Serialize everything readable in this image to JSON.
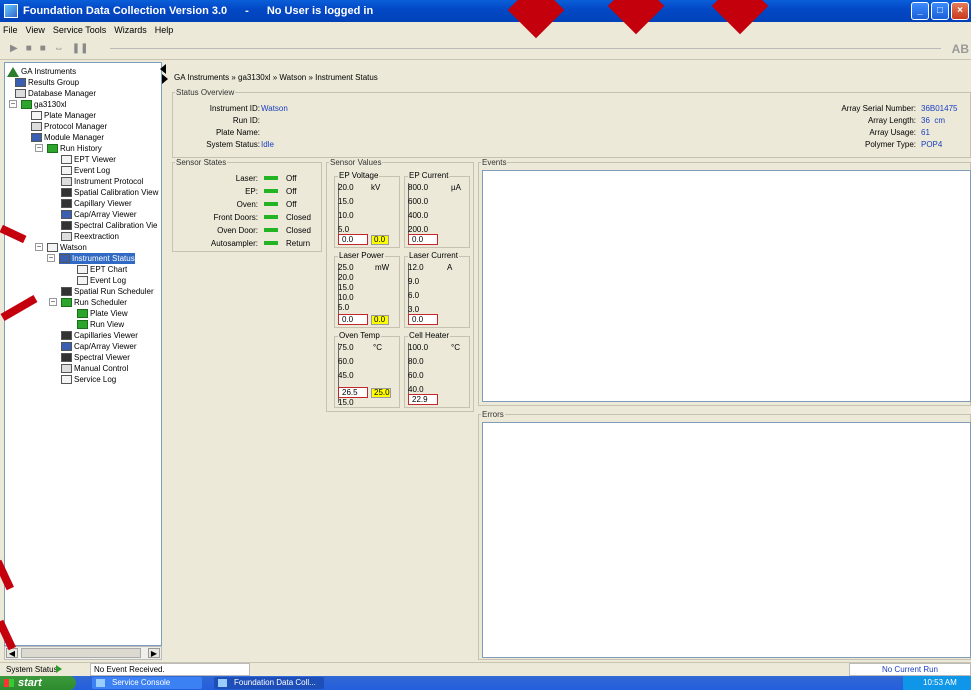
{
  "window": {
    "title": "Foundation Data Collection Version 3.0",
    "separator": "-",
    "user_status": "No User is logged in",
    "brand": "AB"
  },
  "menu": [
    "File",
    "View",
    "Service Tools",
    "Wizards",
    "Help"
  ],
  "tree": {
    "items": [
      {
        "label": "GA Instruments",
        "icon": "triangle-icon"
      },
      {
        "label": "Results Group",
        "icon": "folder-icon"
      },
      {
        "label": "Database Manager",
        "icon": "database-icon"
      },
      {
        "label": "ga3130xl",
        "icon": "instrument-icon"
      },
      {
        "label": "Plate Manager",
        "icon": "plate-icon"
      },
      {
        "label": "Protocol Manager",
        "icon": "protocol-icon"
      },
      {
        "label": "Module Manager",
        "icon": "module-icon"
      },
      {
        "label": "Run History",
        "icon": "history-icon"
      },
      {
        "label": "EPT Viewer",
        "icon": "chart-icon"
      },
      {
        "label": "Event Log",
        "icon": "log-icon"
      },
      {
        "label": "Instrument Protocol",
        "icon": "protocol-icon"
      },
      {
        "label": "Spatial Calibration View",
        "icon": "spatial-icon"
      },
      {
        "label": "Capillary Viewer",
        "icon": "capillary-icon"
      },
      {
        "label": "Cap/Array Viewer",
        "icon": "array-icon"
      },
      {
        "label": "Spectral Calibration Vie",
        "icon": "spectral-icon"
      },
      {
        "label": "Reextraction",
        "icon": "reextraction-icon"
      },
      {
        "label": "Watson",
        "icon": "instrument-icon"
      },
      {
        "label": "Instrument Status",
        "icon": "status-icon"
      },
      {
        "label": "EPT Chart",
        "icon": "chart-icon"
      },
      {
        "label": "Event Log",
        "icon": "log-icon"
      },
      {
        "label": "Spatial Run Scheduler",
        "icon": "spatial-icon"
      },
      {
        "label": "Run Scheduler",
        "icon": "scheduler-icon"
      },
      {
        "label": "Plate View",
        "icon": "plate-icon"
      },
      {
        "label": "Run View",
        "icon": "run-icon"
      },
      {
        "label": "Capillaries Viewer",
        "icon": "capillary-icon"
      },
      {
        "label": "Cap/Array Viewer",
        "icon": "array-icon"
      },
      {
        "label": "Spectral Viewer",
        "icon": "spectral-icon"
      },
      {
        "label": "Manual Control",
        "icon": "hand-icon"
      },
      {
        "label": "Service Log",
        "icon": "log-icon"
      }
    ]
  },
  "breadcrumb": "GA Instruments » ga3130xl » Watson » Instrument Status",
  "status_overview": {
    "legend": "Status Overview",
    "left": [
      {
        "label": "Instrument ID:",
        "value": "Watson"
      },
      {
        "label": "Run ID:",
        "value": ""
      },
      {
        "label": "Plate Name:",
        "value": ""
      },
      {
        "label": "System Status:",
        "value": "Idle"
      }
    ],
    "right": [
      {
        "label": "Array Serial Number:",
        "value": "36B01475"
      },
      {
        "label": "Array Length:",
        "value": "36  cm"
      },
      {
        "label": "Array Usage:",
        "value": "61"
      },
      {
        "label": "Polymer Type:",
        "value": "POP4"
      }
    ]
  },
  "sensor_states": {
    "legend": "Sensor States",
    "items": [
      {
        "label": "Laser:",
        "value": "Off"
      },
      {
        "label": "EP:",
        "value": "Off"
      },
      {
        "label": "Oven:",
        "value": "Off"
      },
      {
        "label": "Front Doors:",
        "value": "Closed"
      },
      {
        "label": "Oven Door:",
        "value": "Closed"
      },
      {
        "label": "Autosampler:",
        "value": "Return"
      }
    ],
    "led_color": "#22b422"
  },
  "sensor_values": {
    "legend": "Sensor Values",
    "gauges": [
      {
        "title": "EP Voltage",
        "unit": "kV",
        "ticks": [
          "20.0",
          "15.0",
          "10.0",
          "5.0"
        ],
        "value": "0.0",
        "setpoint": "0.0"
      },
      {
        "title": "EP Current",
        "unit": "µA",
        "ticks": [
          "800.0",
          "600.0",
          "400.0",
          "200.0"
        ],
        "value": "0.0",
        "setpoint": ""
      },
      {
        "title": "Laser Power",
        "unit": "mW",
        "ticks": [
          "25.0",
          "20.0",
          "15.0",
          "10.0",
          "5.0"
        ],
        "value": "0.0",
        "setpoint": "0.0"
      },
      {
        "title": "Laser Current",
        "unit": "A",
        "ticks": [
          "12.0",
          "9.0",
          "6.0",
          "3.0"
        ],
        "value": "0.0",
        "setpoint": ""
      },
      {
        "title": "Oven Temp",
        "unit": "°C",
        "ticks": [
          "75.0",
          "60.0",
          "45.0"
        ],
        "extra_tick": "15.0",
        "value": "26.5",
        "setpoint": "25.0"
      },
      {
        "title": "Cell Heater",
        "unit": "°C",
        "ticks": [
          "100.0",
          "80.0",
          "60.0",
          "40.0"
        ],
        "value": "22.9",
        "setpoint": ""
      }
    ]
  },
  "events": {
    "legend": "Events"
  },
  "errors": {
    "legend": "Errors"
  },
  "statusbar": {
    "label": "System Status",
    "message": "No Event Received.",
    "run": "No Current Run"
  },
  "taskbar": {
    "start": "start",
    "tasks": [
      "Service Console",
      "Foundation Data Coll..."
    ],
    "clock": "10:53 AM"
  }
}
